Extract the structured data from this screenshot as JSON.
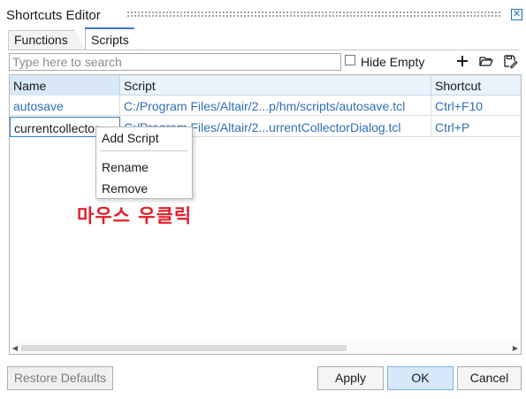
{
  "window": {
    "title": "Shortcuts Editor",
    "close_glyph": "✕"
  },
  "tabs": [
    {
      "label": "Functions",
      "active": false
    },
    {
      "label": "Scripts",
      "active": true
    }
  ],
  "toolbar": {
    "search_placeholder": "Type here to search",
    "search_value": "",
    "hide_empty_label": "Hide Empty",
    "hide_empty_checked": false,
    "icons": [
      "plus-icon",
      "folder-open-icon",
      "save-as-icon"
    ]
  },
  "table": {
    "columns": [
      "Name",
      "Script",
      "Shortcut"
    ],
    "rows": [
      {
        "name": "autosave",
        "script": "C:/Program Files/Altair/2...p/hm/scripts/autosave.tcl",
        "shortcut": "Ctrl+F10"
      },
      {
        "name": "currentcollector",
        "script": "C:/Program Files/Altair/2...urrentCollectorDialog.tcl",
        "shortcut": "Ctrl+P"
      }
    ]
  },
  "context_menu": {
    "items": [
      "Add Script",
      "Rename",
      "Remove"
    ]
  },
  "annotation": {
    "text": "마우스 우클릭",
    "color": "#e0202a"
  },
  "buttons": {
    "restore": "Restore Defaults",
    "apply": "Apply",
    "ok": "OK",
    "cancel": "Cancel"
  },
  "colors": {
    "link": "#2f6fb6",
    "accent": "#3a78c2",
    "header_bg": "#eaf2fb"
  }
}
